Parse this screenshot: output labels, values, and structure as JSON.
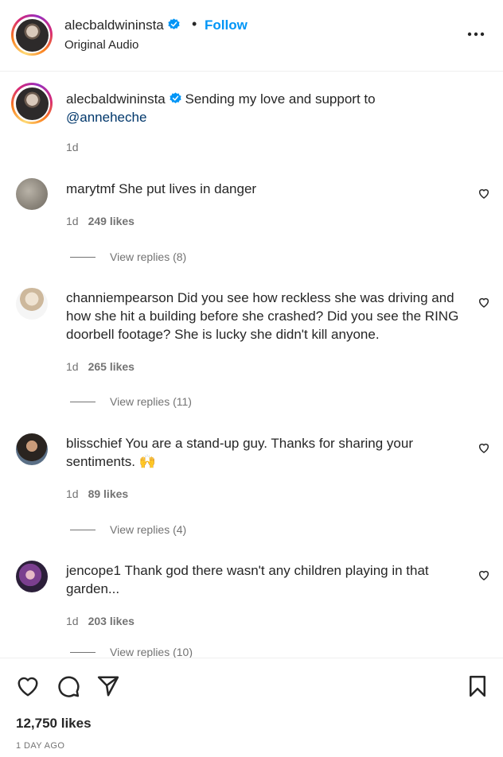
{
  "header": {
    "username": "alecbaldwininsta",
    "separator": "•",
    "follow_label": "Follow",
    "audio_label": "Original Audio"
  },
  "caption": {
    "username": "alecbaldwininsta",
    "text": "Sending my love and support to",
    "mention": "@anneheche",
    "time": "1d"
  },
  "comments": [
    {
      "username": "marytmf",
      "text": "She put lives in danger",
      "time": "1d",
      "likes": "249 likes",
      "replies": "View replies (8)"
    },
    {
      "username": "channiempearson",
      "text": "Did you see how reckless she was driving and how she hit a building before she crashed? Did you see the RING doorbell footage? She is lucky she didn't kill anyone.",
      "time": "1d",
      "likes": "265 likes",
      "replies": "View replies (11)"
    },
    {
      "username": "blisschief",
      "text": "You are a stand-up guy. Thanks for sharing your sentiments.",
      "emoji": "🙌",
      "time": "1d",
      "likes": "89 likes",
      "replies": "View replies (4)"
    },
    {
      "username": "jencope1",
      "text": "Thank god there wasn't any children playing in that garden...",
      "time": "1d",
      "likes": "203 likes",
      "replies": "View replies (10)"
    }
  ],
  "footer": {
    "likes_count": "12,750 likes",
    "posted": "1 DAY AGO"
  },
  "icons": {
    "verified": "verified-badge-icon",
    "more": "more-options-icon",
    "like": "heart-icon",
    "comment": "comment-icon",
    "share": "paper-plane-icon",
    "save": "bookmark-icon"
  },
  "colors": {
    "accent": "#0095f6",
    "mention": "#00376b",
    "secondary_text": "#737373"
  }
}
